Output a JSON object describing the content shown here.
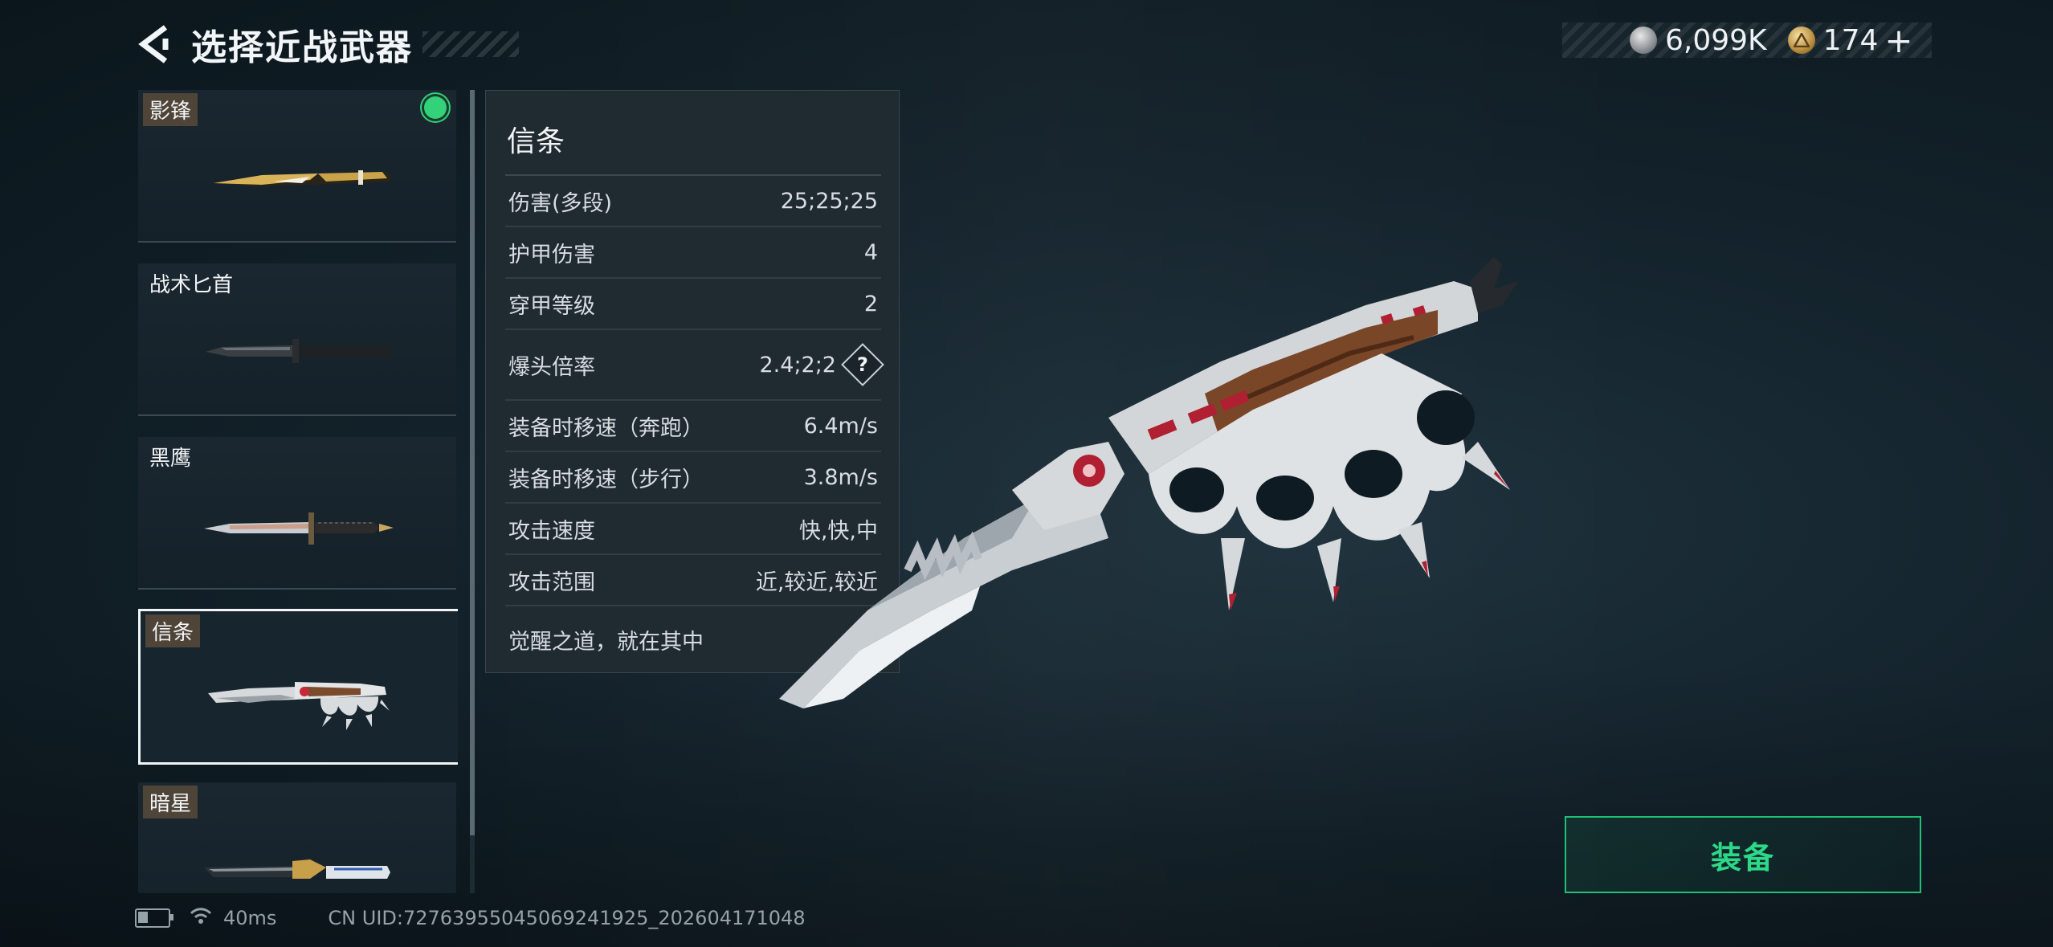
{
  "header": {
    "title": "选择近战武器"
  },
  "currency": [
    {
      "icon": "silver-coin-icon",
      "value": "6,099K"
    },
    {
      "icon": "gold-coin-icon",
      "value": "174"
    }
  ],
  "currency_plus": "+",
  "weapons": [
    {
      "name": "影锋",
      "tagged": true,
      "equipped": true,
      "selected": false
    },
    {
      "name": "战术匕首",
      "tagged": false,
      "equipped": false,
      "selected": false
    },
    {
      "name": "黑鹰",
      "tagged": false,
      "equipped": false,
      "selected": false
    },
    {
      "name": "信条",
      "tagged": true,
      "equipped": false,
      "selected": true
    },
    {
      "name": "暗星",
      "tagged": true,
      "equipped": false,
      "selected": false
    }
  ],
  "details": {
    "name": "信条",
    "stats": [
      {
        "label": "伤害(多段)",
        "value": "25;25;25",
        "help": false
      },
      {
        "label": "护甲伤害",
        "value": "4",
        "help": false
      },
      {
        "label": "穿甲等级",
        "value": "2",
        "help": false
      },
      {
        "label": "爆头倍率",
        "value": "2.4;2;2",
        "help": true
      },
      {
        "label": "装备时移速（奔跑）",
        "value": "6.4m/s",
        "help": false
      },
      {
        "label": "装备时移速（步行）",
        "value": "3.8m/s",
        "help": false
      },
      {
        "label": "攻击速度",
        "value": "快,快,中",
        "help": false
      },
      {
        "label": "攻击范围",
        "value": "近,较近,较近",
        "help": false
      }
    ],
    "help_symbol": "?",
    "description": "觉醒之道，就在其中"
  },
  "equip_button": {
    "label": "装备"
  },
  "footer": {
    "ping": "40ms",
    "uid": "CN UID:7276395504506924​1925_202604171048"
  },
  "colors": {
    "accent_green": "#2ed889",
    "tag_bg": "#4f4438",
    "panel_bg": "#202a31"
  }
}
